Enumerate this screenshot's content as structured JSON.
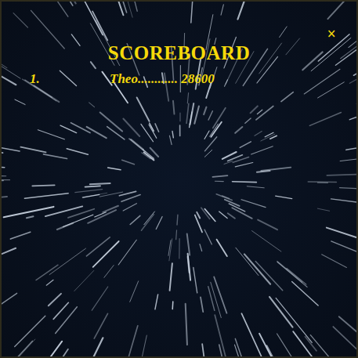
{
  "panel": {
    "title": "SCOREBOARD",
    "close": "×"
  },
  "entries": [
    {
      "rank": "1.",
      "label": "Theo............ 28600"
    }
  ]
}
